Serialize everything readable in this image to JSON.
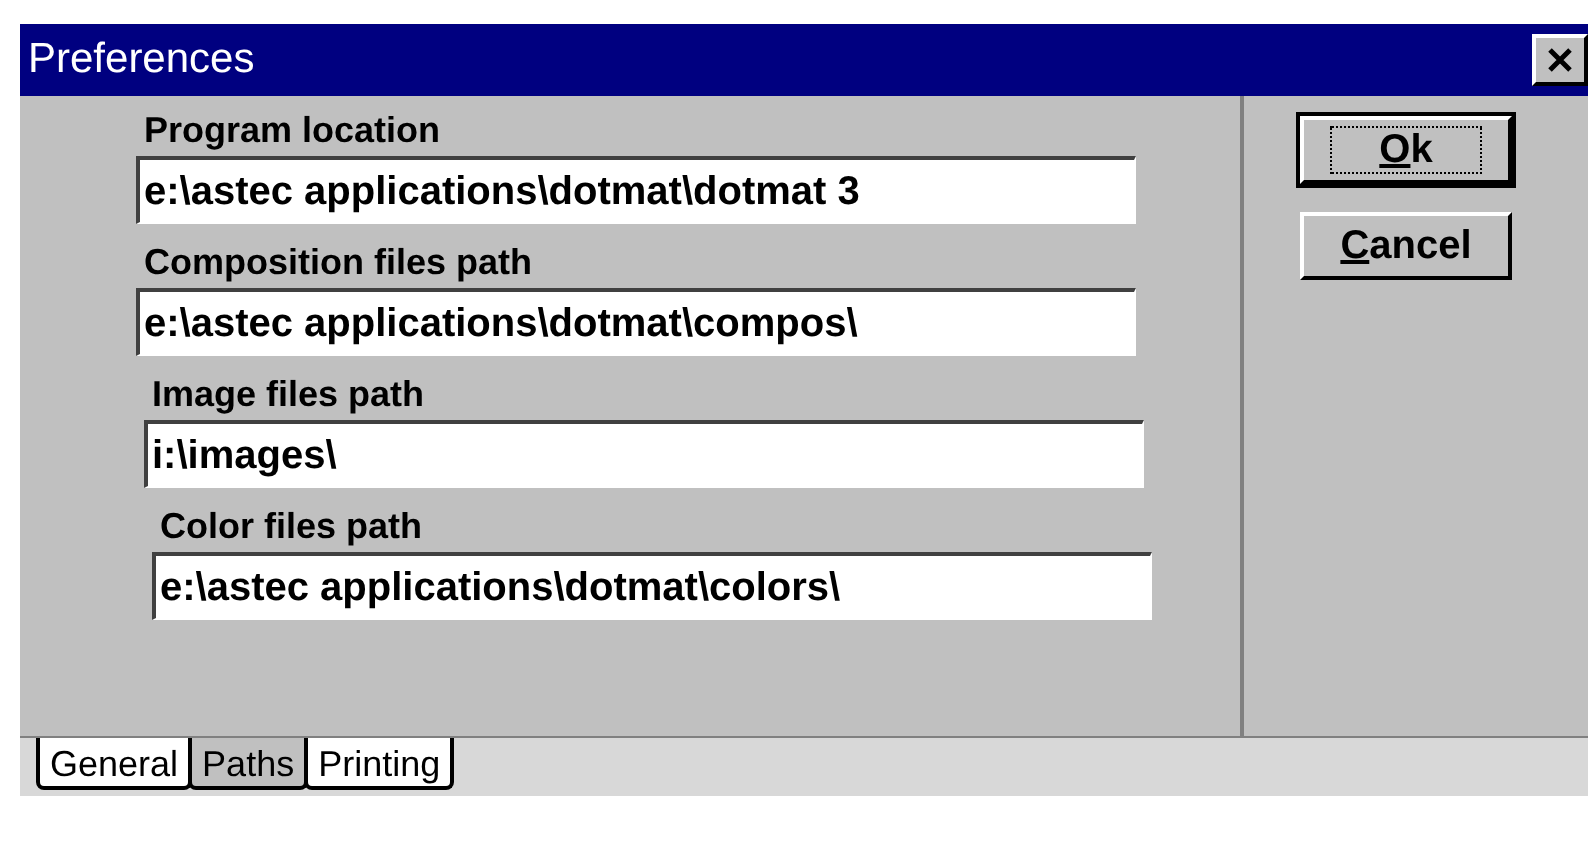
{
  "window": {
    "title": "Preferences"
  },
  "fields": [
    {
      "label": "Program location",
      "value": "e:\\astec applications\\dotmat\\dotmat 3"
    },
    {
      "label": "Composition files path",
      "value": "e:\\astec applications\\dotmat\\compos\\"
    },
    {
      "label": "Image files path",
      "value": "i:\\images\\"
    },
    {
      "label": "Color files path",
      "value": "e:\\astec applications\\dotmat\\colors\\"
    }
  ],
  "buttons": [
    {
      "label": "Ok",
      "default": true
    },
    {
      "label": "Cancel",
      "default": false
    }
  ],
  "tabs": [
    {
      "label": "General",
      "selected": false
    },
    {
      "label": "Paths",
      "selected": true
    },
    {
      "label": "Printing",
      "selected": false
    }
  ]
}
